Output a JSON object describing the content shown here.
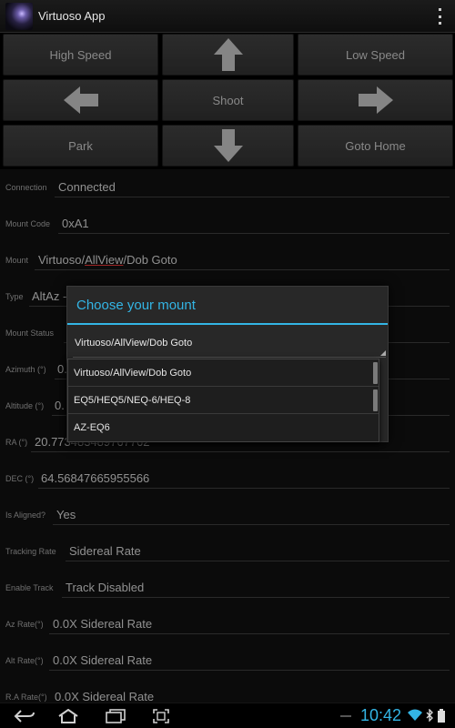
{
  "app": {
    "title": "Virtuoso App"
  },
  "controls": {
    "high_speed": "High Speed",
    "low_speed": "Low Speed",
    "shoot": "Shoot",
    "park": "Park",
    "goto_home": "Goto Home",
    "up_icon": "arrow-up-icon",
    "down_icon": "arrow-down-icon",
    "left_icon": "arrow-left-icon",
    "right_icon": "arrow-right-icon"
  },
  "form": {
    "connection": {
      "label": "Connection",
      "value": "Connected"
    },
    "mount_code": {
      "label": "Mount Code",
      "value": "0xA1"
    },
    "mount": {
      "label": "Mount",
      "value_prefix": "Virtuoso/",
      "value_spell": "AllView",
      "value_suffix": "/Dob Goto"
    },
    "type": {
      "label": "Type",
      "value": "AltAz -"
    },
    "mount_status": {
      "label": "Mount Status",
      "value": ""
    },
    "azimuth": {
      "label": "Azimuth (°)",
      "value": "0."
    },
    "altitude": {
      "label": "Altitude (°)",
      "value": "0."
    },
    "ra": {
      "label": "RA (°)",
      "value": "20.773483489767762"
    },
    "dec": {
      "label": "DEC (°)",
      "value": "64.56847665955566"
    },
    "is_aligned": {
      "label": "Is Aligned?",
      "value": "Yes"
    },
    "tracking_rate": {
      "label": "Tracking Rate",
      "value": "Sidereal Rate"
    },
    "enable_track": {
      "label": "Enable Track",
      "value": "Track Disabled"
    },
    "az_rate": {
      "label": "Az Rate(°)",
      "value": "0.0X Sidereal Rate"
    },
    "alt_rate": {
      "label": "Alt Rate(°)",
      "value": "0.0X Sidereal Rate"
    },
    "ra_rate": {
      "label": "R.A Rate(°)",
      "value": "0.0X Sidereal Rate"
    }
  },
  "dialog": {
    "title": "Choose your mount",
    "selected": "Virtuoso/AllView/Dob Goto",
    "options": [
      "Virtuoso/AllView/Dob Goto",
      "EQ5/HEQ5/NEQ-6/HEQ-8",
      "AZ-EQ6"
    ]
  },
  "navbar": {
    "time": "10:42",
    "back_icon": "back-icon",
    "home_icon": "home-icon",
    "recents_icon": "recents-icon",
    "screenshot_icon": "screenshot-icon",
    "wifi_icon": "wifi-icon",
    "battery_icon": "battery-icon",
    "bluetooth_icon": "bluetooth-icon"
  },
  "colors": {
    "accent": "#33b5e5",
    "background": "#101010",
    "button": "#363636"
  }
}
